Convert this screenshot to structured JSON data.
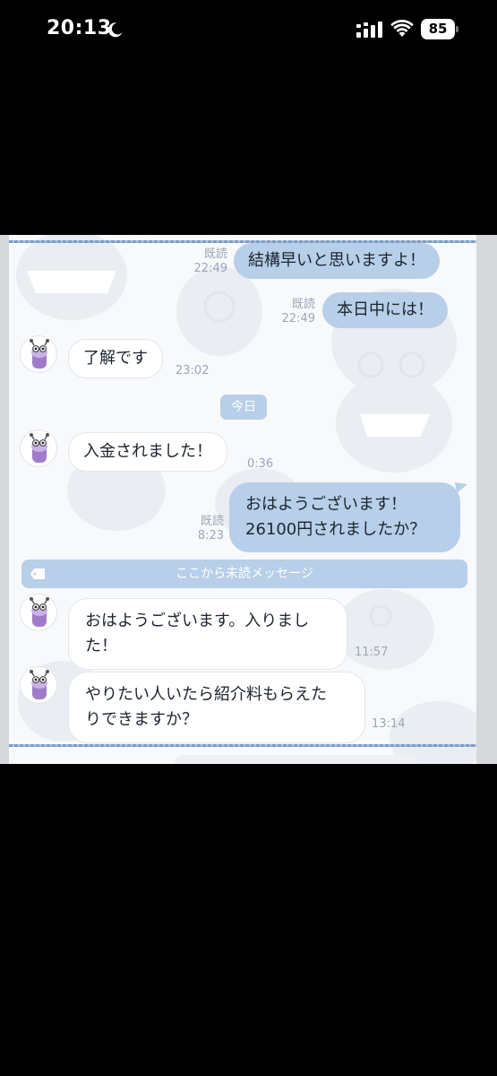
{
  "status_bar": {
    "time": "20:13",
    "battery": "85",
    "icons": [
      "moon-icon",
      "signal-icon",
      "wifi-icon",
      "battery-icon"
    ]
  },
  "chat": {
    "messages": [
      {
        "id": "m1",
        "direction": "outgoing",
        "text": "結構早いと思いますよ！",
        "read": "既読",
        "time": "22:49"
      },
      {
        "id": "m2",
        "direction": "outgoing",
        "text": "本日中には！",
        "read": "既読",
        "time": "22:49"
      },
      {
        "id": "m3",
        "direction": "incoming",
        "text": "了解です",
        "time": "23:02"
      },
      {
        "id": "m4",
        "direction": "incoming",
        "text": "入金されました！",
        "time": "0:36"
      },
      {
        "id": "m5",
        "direction": "outgoing",
        "line1": "おはようございます！",
        "line2": "26100円されましたか？",
        "read": "既読",
        "time": "8:23"
      },
      {
        "id": "m6",
        "direction": "incoming",
        "line1": "おはようございます。入りまし",
        "line2": "た！",
        "time": "11:57"
      },
      {
        "id": "m7",
        "direction": "incoming",
        "line1": "やりたい人いたら紹介料もらえた",
        "line2": "りできますか？",
        "time": "13:14"
      }
    ],
    "date_divider": "今日",
    "unread_divider": "ここから未読メッセージ"
  },
  "colors": {
    "outgoing_bubble": "#b7cfe8",
    "incoming_bubble": "#ffffff",
    "meta_text": "#9aa7b6",
    "chat_background": "#f8f9fb"
  }
}
